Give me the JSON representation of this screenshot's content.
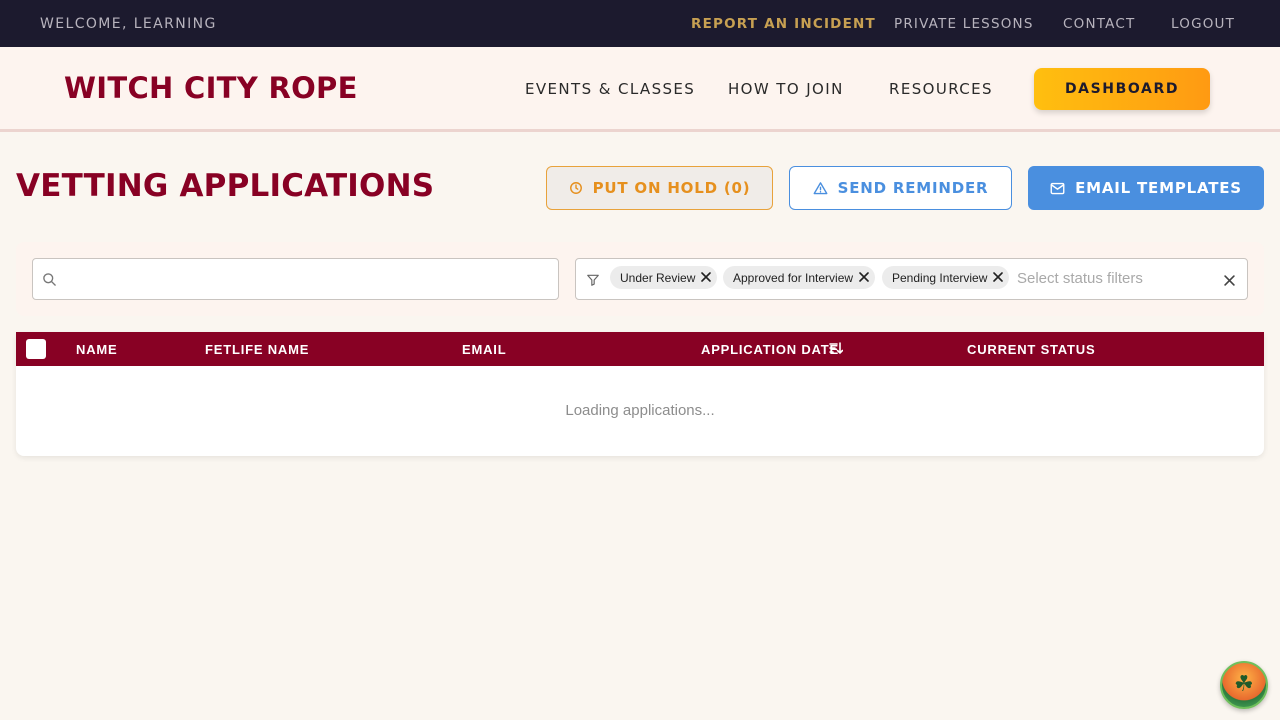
{
  "utility": {
    "welcome": "WELCOME, LEARNING",
    "links": [
      "REPORT AN INCIDENT",
      "PRIVATE LESSONS",
      "CONTACT",
      "LOGOUT"
    ]
  },
  "header": {
    "brand": "WITCH CITY ROPE",
    "nav": [
      "EVENTS & CLASSES",
      "HOW TO JOIN",
      "RESOURCES"
    ],
    "dashboard": "DASHBOARD"
  },
  "page": {
    "title": "VETTING APPLICATIONS",
    "actions": {
      "hold": "PUT ON HOLD (0)",
      "remind": "SEND REMINDER",
      "templates": "EMAIL TEMPLATES"
    }
  },
  "filters": {
    "search_value": "",
    "chips": [
      "Under Review",
      "Approved for Interview",
      "Pending Interview"
    ],
    "status_placeholder": "Select status filters"
  },
  "table": {
    "columns": [
      "NAME",
      "FETLIFE NAME",
      "EMAIL",
      "APPLICATION DATE",
      "CURRENT STATUS"
    ],
    "loading": "Loading applications..."
  },
  "icons": {
    "hold": "clock-icon",
    "remind": "alert-triangle-icon",
    "templates": "mail-icon",
    "search": "search-icon",
    "filter": "filter-icon",
    "sort": "sort-descending-icon"
  },
  "colors": {
    "brand": "#880124",
    "accent_gold": "#c7a052",
    "hold": "#e6901e",
    "blue": "#4a8fdf",
    "dashboard_gradient_start": "#ffbf0f",
    "dashboard_gradient_end": "#ff9a12"
  }
}
